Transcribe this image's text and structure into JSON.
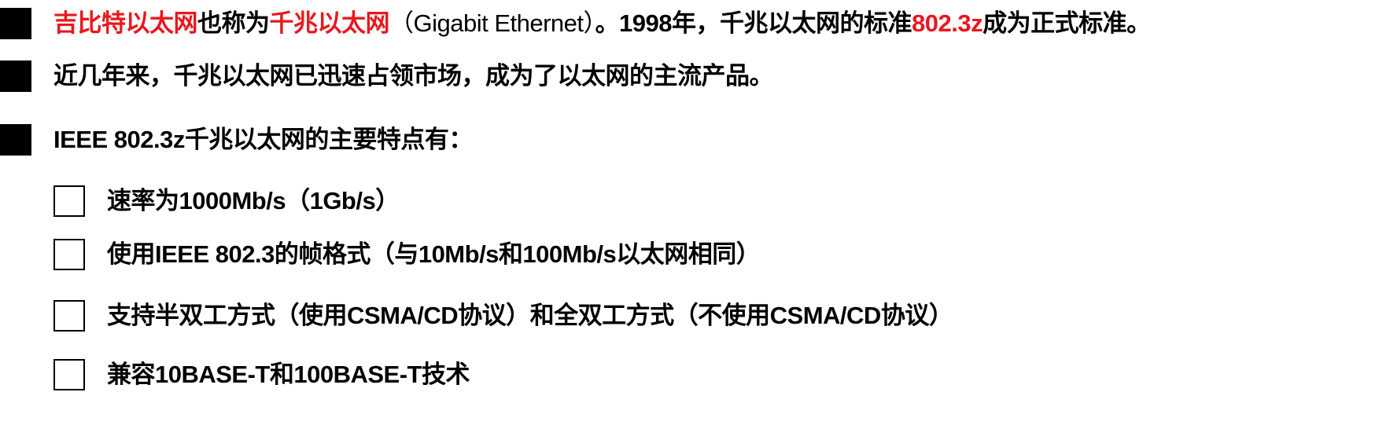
{
  "bullets": [
    {
      "segments": [
        {
          "text": "吉比特以太网",
          "color": "red",
          "weight": "bold"
        },
        {
          "text": "也称为",
          "color": "black",
          "weight": "bold"
        },
        {
          "text": "千兆以太网",
          "color": "red",
          "weight": "bold"
        },
        {
          "text": "（Gigabit Ethernet）",
          "color": "black",
          "weight": "normal"
        },
        {
          "text": "。1998年，千兆以太网的标准",
          "color": "black",
          "weight": "bold"
        },
        {
          "text": "802.3z",
          "color": "red",
          "weight": "bold"
        },
        {
          "text": "成为正式标准。",
          "color": "black",
          "weight": "bold"
        }
      ]
    },
    {
      "text": "近几年来，千兆以太网已迅速占领市场，成为了以太网的主流产品。"
    },
    {
      "text": "IEEE 802.3z千兆以太网的主要特点有："
    }
  ],
  "features": [
    {
      "text": "速率为1000Mb/s（1Gb/s）"
    },
    {
      "text": "使用IEEE 802.3的帧格式（与10Mb/s和100Mb/s以太网相同）"
    },
    {
      "text": "支持半双工方式（使用CSMA/CD协议）和全双工方式（不使用CSMA/CD协议）"
    },
    {
      "text": "兼容10BASE-T和100BASE-T技术"
    }
  ],
  "colors": {
    "accent_red": "#e8181f",
    "text": "#000000",
    "background": "#ffffff"
  }
}
